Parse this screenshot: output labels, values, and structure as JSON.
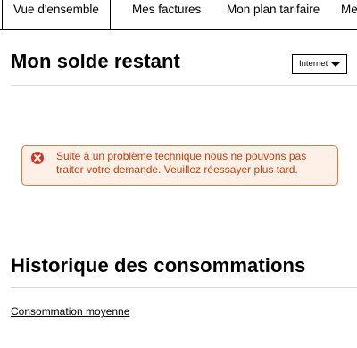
{
  "tabs": [
    {
      "label": "Vue d'ensemble",
      "active": true
    },
    {
      "label": "Mes factures",
      "active": false
    },
    {
      "label": "Mon plan tarifaire",
      "active": false
    },
    {
      "label": "Me",
      "active": false
    }
  ],
  "balance_section": {
    "title": "Mon solde restant",
    "select": {
      "value": "Internet"
    }
  },
  "error_alert": {
    "icon": "error-circle-icon",
    "message": "Suite à un problème technique nous ne pouvons pas traiter votre demande. Veuillez réessayer plus tard."
  },
  "history_section": {
    "title": "Historique des consommations",
    "link_label": "Consommation moyenne"
  },
  "colors": {
    "alert_background": "#fef0e6",
    "alert_border": "#e07a35",
    "alert_text": "#c2410c",
    "error_icon": "#d6342a"
  }
}
